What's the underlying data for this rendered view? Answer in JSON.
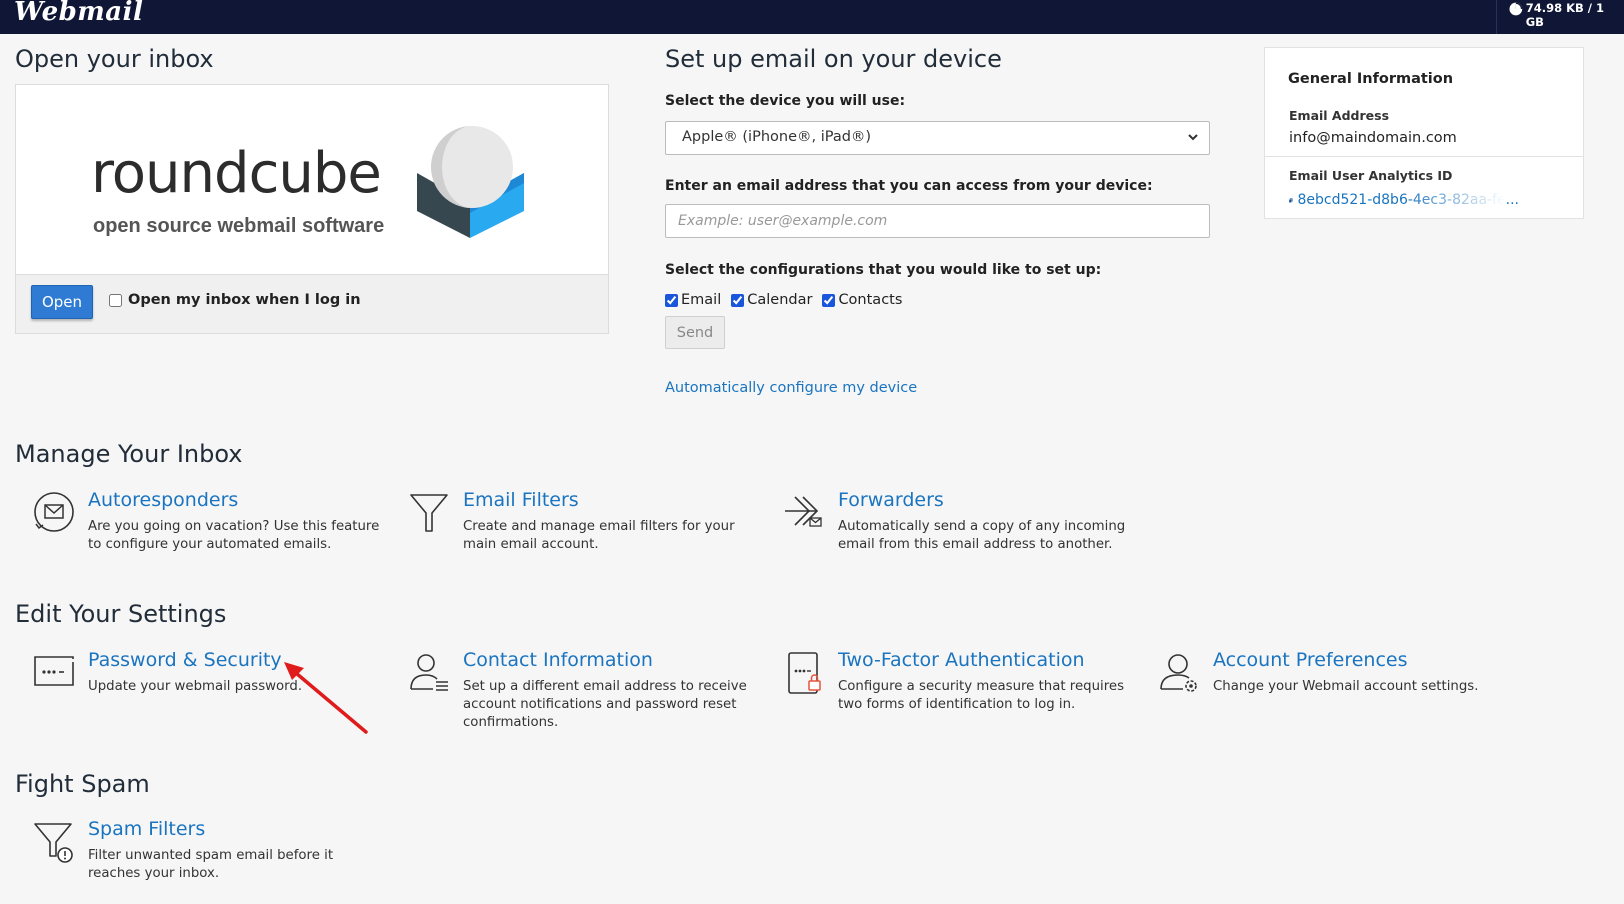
{
  "topbar": {
    "logo": "Webmail",
    "quota": "74.98 KB / 1 GB"
  },
  "open_inbox": {
    "heading": "Open your inbox",
    "brand_word": "roundcube",
    "brand_tag": "open source webmail software",
    "open_button": "Open",
    "auto_open_label": "Open my inbox when I log in"
  },
  "setup": {
    "heading": "Set up email on your device",
    "device_label": "Select the device you will use:",
    "device_value": "Apple® (iPhone®, iPad®)",
    "email_label": "Enter an email address that you can access from your device:",
    "email_placeholder": "Example: user@example.com",
    "config_label": "Select the configurations that you would like to set up:",
    "configs": [
      "Email",
      "Calendar",
      "Contacts"
    ],
    "send_button": "Send",
    "auto_link": "Automatically configure my device"
  },
  "general_info": {
    "title": "General Information",
    "email_label": "Email Address",
    "email_value": "info@maindomain.com",
    "analytics_label": "Email User Analytics ID",
    "analytics_value": "8ebcd521-d8b6-4ec3-82aa-fe..."
  },
  "manage": {
    "heading": "Manage Your Inbox",
    "items": [
      {
        "title": "Autoresponders",
        "desc": "Are you going on vacation? Use this feature to configure your automated emails.",
        "icon": "autoresponder-icon"
      },
      {
        "title": "Email Filters",
        "desc": "Create and manage email filters for your main email account.",
        "icon": "filter-icon"
      },
      {
        "title": "Forwarders",
        "desc": "Automatically send a copy of any incoming email from this email address to another.",
        "icon": "forward-icon"
      }
    ]
  },
  "settings": {
    "heading": "Edit Your Settings",
    "items": [
      {
        "title": "Password & Security",
        "desc": "Update your webmail password.",
        "icon": "password-icon"
      },
      {
        "title": "Contact Information",
        "desc": "Set up a different email address to receive account notifications and password reset confirmations.",
        "icon": "contact-icon"
      },
      {
        "title": "Two-Factor Authentication",
        "desc": "Configure a security measure that requires two forms of identification to log in.",
        "icon": "two-factor-icon"
      },
      {
        "title": "Account Preferences",
        "desc": "Change your Webmail account settings.",
        "icon": "preferences-icon"
      }
    ]
  },
  "spam": {
    "heading": "Fight Spam",
    "items": [
      {
        "title": "Spam Filters",
        "desc": "Filter unwanted spam email before it reaches your inbox.",
        "icon": "spam-filter-icon"
      }
    ]
  },
  "colors": {
    "topbar": "#101636",
    "link": "#1a74c0",
    "primary_button": "#2f7bd3",
    "annotation_arrow": "#e01b1b"
  }
}
